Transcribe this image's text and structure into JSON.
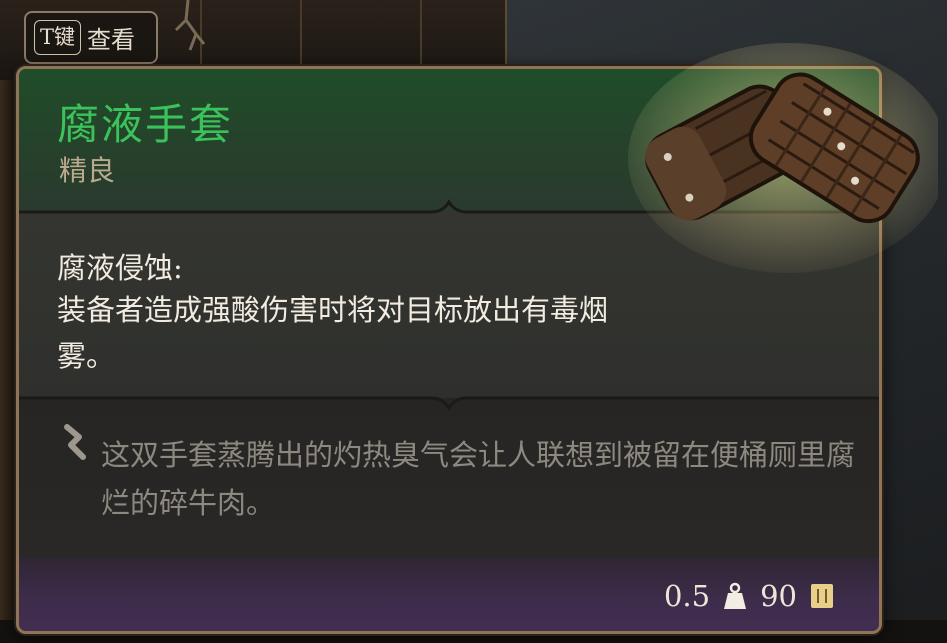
{
  "key_hint": {
    "key": "T键",
    "action": "查看"
  },
  "item": {
    "name": "腐液手套",
    "rarity": "精良",
    "effect_title": "腐液侵蚀:",
    "effect_description": "装备者造成强酸伤害时将对目标放出有毒烟雾。",
    "flavor_text": "这双手套蒸腾出的灼热臭气会让人联想到被留在便桶厕里腐烂的碎牛肉。",
    "weight": "0.5",
    "price": "90",
    "icons": {
      "weight": "weight-icon",
      "price": "gold-coin-icon",
      "flavor": "quill-icon"
    }
  },
  "colors": {
    "name": "#3cc25a",
    "rarity": "#b9a98f",
    "frame": "#8f7556"
  }
}
